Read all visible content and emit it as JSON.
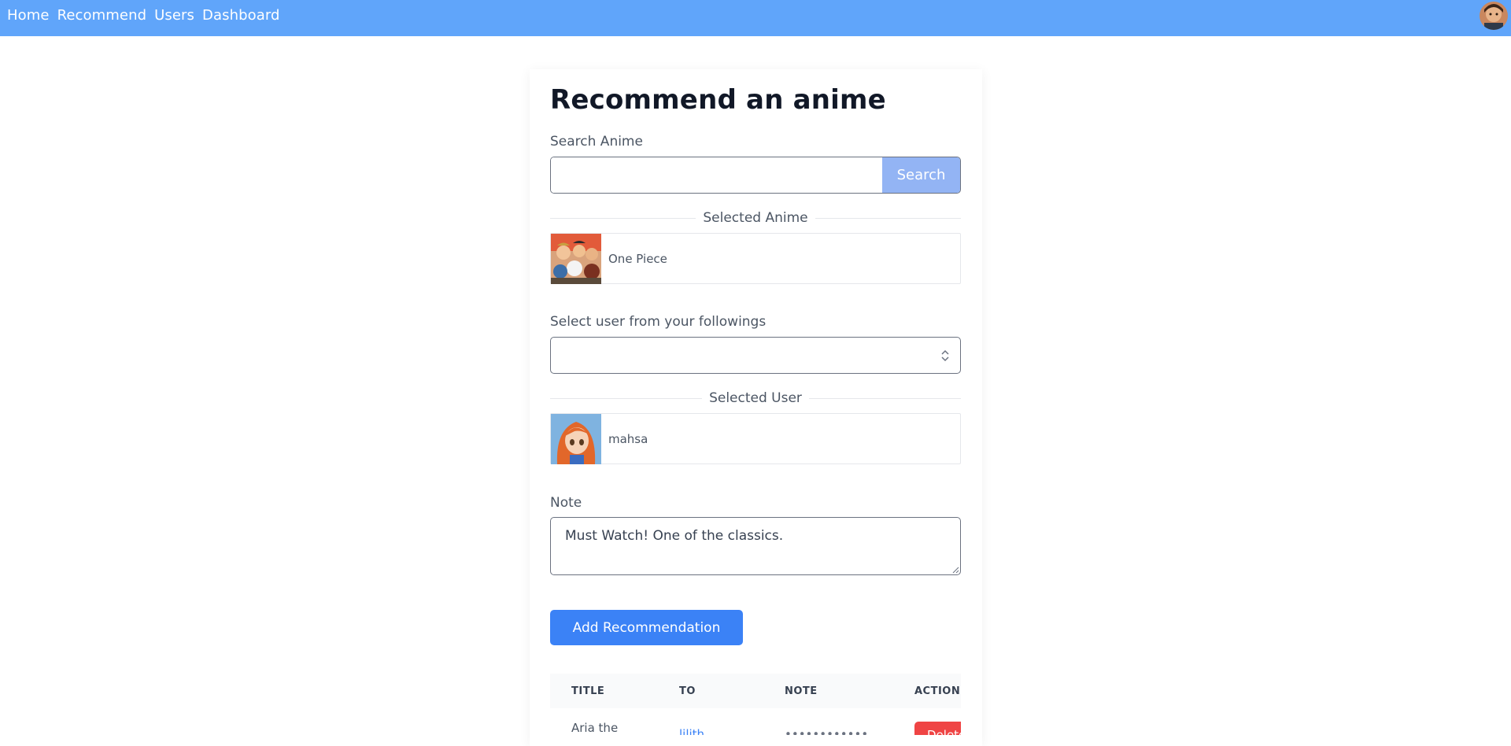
{
  "nav": {
    "links": [
      "Home",
      "Recommend",
      "Users",
      "Dashboard"
    ]
  },
  "page": {
    "title": "Recommend an anime"
  },
  "search": {
    "label": "Search Anime",
    "value": "",
    "button_label": "Search"
  },
  "selected_anime": {
    "divider_label": "Selected Anime",
    "name": "One Piece"
  },
  "user_select": {
    "label": "Select user from your followings",
    "value": ""
  },
  "selected_user": {
    "divider_label": "Selected User",
    "name": "mahsa"
  },
  "note": {
    "label": "Note",
    "value": "Must Watch! One of the classics."
  },
  "add_button": {
    "label": "Add Recommendation"
  },
  "table": {
    "headers": [
      "TITLE",
      "TO",
      "NOTE",
      "ACTIONS"
    ],
    "rows": [
      {
        "title": "Aria the",
        "to": "lilith",
        "note": "••••••••••••",
        "action": "Delete"
      }
    ]
  },
  "colors": {
    "nav_bg": "#60a5fa",
    "primary": "#3b82f6",
    "search_button": "#93b4f4",
    "danger": "#ef4444"
  }
}
